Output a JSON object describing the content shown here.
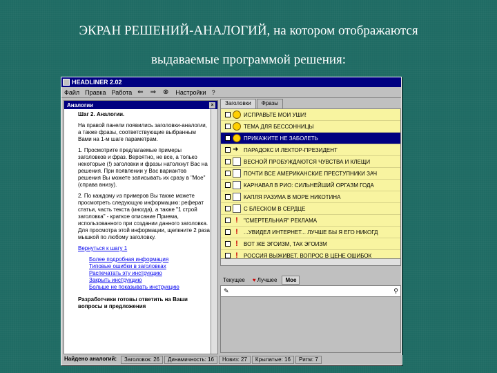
{
  "slide": {
    "title_line1": "ЭКРАН РЕШЕНИЙ-АНАЛОГИЙ, на котором отображаются",
    "title_line2": "выдаваемые программой решения:"
  },
  "window": {
    "title": "HEADLINER 2.02",
    "menu": [
      "Файл",
      "Правка",
      "Работа",
      "Настройки",
      "?"
    ],
    "nav": {
      "back": "⇐",
      "forward": "⇒"
    }
  },
  "help_panel": {
    "title": "Аналогии",
    "close": "×",
    "step": "Шаг 2. Аналогии.",
    "paragraphs": [
      "На правой панели появились заголовки-аналогии, а также фразы, соответствующие выбранным Вами на 1-м шаге параметрам.",
      "1. Просмотрите предлагаемые примеры заголовков и фраз. Вероятно, не все, а только некоторые (!) заголовки и фразы натолкнут Вас на решения. При появлении у Вас вариантов решения Вы можете записывать их сразу в \"Мое\" (справа внизу).",
      "2. По каждому из примеров Вы также можете просмотреть следующую информацию: реферат статьи, часть текста (иногда), а также \"1 строй заголовка\" - краткое описание Приема, использованного при создании данного заголовка. Для просмотра этой информации, щелкните 2 раза мышкой по любому заголовку."
    ],
    "back_link": "Вернуться к шагу 1",
    "links": [
      "Более подробная информация",
      "Типовые ошибки в заголовках",
      "Распечатать эту инструкцию",
      "Закрыть инструкцию",
      "Больше не показывать инструкцию"
    ],
    "footer": "Разработчики готовы ответить на Ваши вопросы и предложения"
  },
  "right_panel": {
    "tabs": [
      "Заголовки",
      "Фразы"
    ],
    "rows": [
      {
        "text": "ИСПРАВЬТЕ МОИ УШИ!",
        "icon": "smile-icon",
        "selected": false
      },
      {
        "text": "ТЕМА ДЛЯ БЕССОННИЦЫ",
        "icon": "smile-icon",
        "selected": false
      },
      {
        "text": "ПРИКАЖИТЕ НЕ ЗАБОЛЕТЬ",
        "icon": "smile-icon",
        "selected": true
      },
      {
        "text": "ПАРАДОКС И ЛЕКТОР-ПРЕЗИДЕНТ",
        "icon": "arrow-icon",
        "selected": false
      },
      {
        "text": "ВЕСНОЙ ПРОБУЖДАЮТСЯ ЧУВСТВА И КЛЕЩИ",
        "icon": "blank-icon",
        "selected": false
      },
      {
        "text": "ПОЧТИ ВСЕ АМЕРИКАНСКИЕ ПРЕСТУПНИКИ ЗАЧ",
        "icon": "blank-icon",
        "selected": false
      },
      {
        "text": "КАРНАВАЛ В РИО: СИЛЬНЕЙШИЙ ОРГАЗМ ГОДА",
        "icon": "blank-icon",
        "selected": false
      },
      {
        "text": "КАПЛЯ РАЗУМА В МОРЕ НИКОТИНА",
        "icon": "blank-icon",
        "selected": false
      },
      {
        "text": "С БЛЕСКОМ В СЕРДЦЕ",
        "icon": "blank-icon",
        "selected": false
      },
      {
        "text": "\"СМЕРТЕЛЬНАЯ\" РЕКЛАМА",
        "icon": "exclaim-icon",
        "selected": false
      },
      {
        "text": "...УВИДЕЛ ИНТЕРНЕТ... ЛУЧШЕ БЫ Я ЕГО НИКОГД",
        "icon": "exclaim-icon",
        "selected": false
      },
      {
        "text": "ВОТ ЖЕ ЭГОИЗМ, ТАК ЭГОИЗМ",
        "icon": "exclaim-icon",
        "selected": false
      },
      {
        "text": "РОССИЯ ВЫЖИВЕТ. ВОПРОС В ЦЕНЕ ОШИБОК",
        "icon": "exclaim-icon",
        "selected": false
      }
    ]
  },
  "bottom_tabs": [
    "Текущее",
    "Лучшее",
    "Мое"
  ],
  "status": {
    "found_label": "Найдено аналогий:",
    "headlines": "Заголовок: 26",
    "dynamics": "Динамичность: 16",
    "novelty": "Новиз: 27",
    "wings": "Крылатые: 16",
    "rhythm": "Ритм: 7"
  }
}
